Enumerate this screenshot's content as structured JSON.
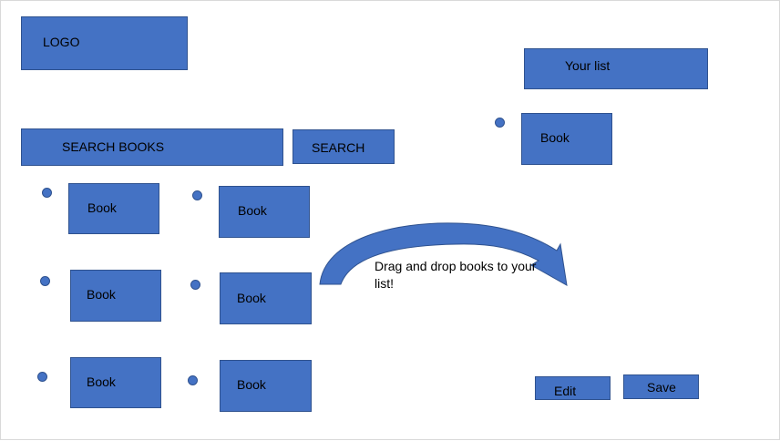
{
  "header": {
    "logo_label": "LOGO"
  },
  "search": {
    "field_label": "SEARCH BOOKS",
    "button_label": "SEARCH"
  },
  "results": {
    "items": [
      {
        "label": "Book"
      },
      {
        "label": "Book"
      },
      {
        "label": "Book"
      },
      {
        "label": "Book"
      },
      {
        "label": "Book"
      },
      {
        "label": "Book"
      }
    ]
  },
  "your_list": {
    "title": "Your list",
    "items": [
      {
        "label": "Book"
      }
    ]
  },
  "hint": {
    "text": "Drag and drop books to your list!",
    "icon": "curved-arrow-icon"
  },
  "actions": {
    "edit_label": "Edit",
    "save_label": "Save"
  },
  "colors": {
    "box_fill": "#4472c4",
    "box_border": "#2f528f"
  }
}
